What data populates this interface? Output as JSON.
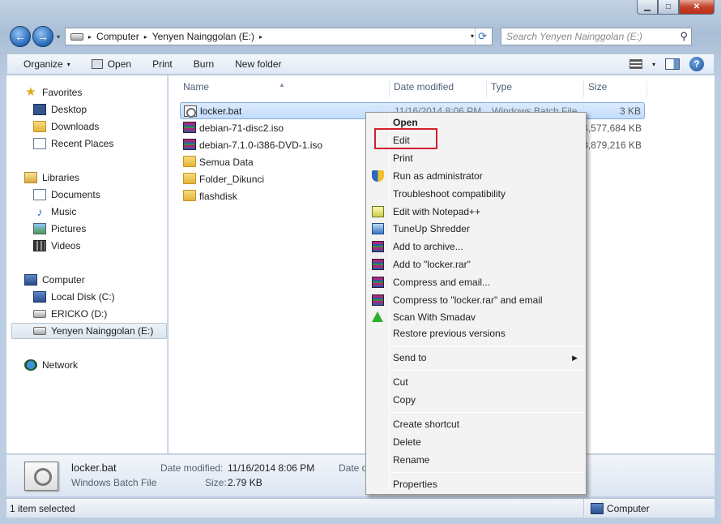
{
  "window": {
    "caption": {
      "minimize": "▁",
      "maximize": "□",
      "close": "✕"
    }
  },
  "nav": {
    "back": "←",
    "forward": "→",
    "dropdown": "▾",
    "address": {
      "segments": [
        "Computer",
        "Yenyen Nainggolan (E:)"
      ],
      "separator": "▸"
    },
    "search_placeholder": "Search Yenyen Nainggolan (E:)"
  },
  "toolbar": {
    "items": [
      "Organize",
      "Open",
      "Print",
      "Burn",
      "New folder"
    ],
    "dropdown_glyph": "▾"
  },
  "navpane": {
    "favorites_header": "Favorites",
    "favorites": [
      "Desktop",
      "Downloads",
      "Recent Places"
    ],
    "libraries_header": "Libraries",
    "libraries": [
      "Documents",
      "Music",
      "Pictures",
      "Videos"
    ],
    "computer_header": "Computer",
    "drives": [
      "Local Disk (C:)",
      "ERICKO (D:)",
      "Yenyen Nainggolan (E:)"
    ],
    "network": "Network"
  },
  "columns": {
    "name": "Name",
    "date": "Date modified",
    "type": "Type",
    "size": "Size"
  },
  "files": [
    {
      "name": "locker.bat",
      "date": "11/16/2014 8:06 PM",
      "type": "Windows Batch File",
      "size": "3 KB",
      "icon": "batch-file-icon"
    },
    {
      "name": "debian-71-disc2.iso",
      "date": "",
      "type": "",
      "size": "4,577,684 KB",
      "icon": "winrar-archive-icon"
    },
    {
      "name": "debian-7.1.0-i386-DVD-1.iso",
      "date": "",
      "type": "",
      "size": "3,879,216 KB",
      "icon": "winrar-archive-icon"
    },
    {
      "name": "Semua Data",
      "date": "",
      "type": "",
      "size": "",
      "icon": "folder-icon"
    },
    {
      "name": "Folder_Dikunci",
      "date": "",
      "type": "",
      "size": "",
      "icon": "folder-icon"
    },
    {
      "name": "flashdisk",
      "date": "",
      "type": "",
      "size": "",
      "icon": "folder-icon"
    }
  ],
  "context_menu": {
    "items": [
      {
        "label": "Open",
        "bold": true,
        "icon": ""
      },
      {
        "label": "Edit",
        "icon": ""
      },
      {
        "label": "Print",
        "icon": ""
      },
      {
        "label": "Run as administrator",
        "icon": "uac-shield-icon"
      },
      {
        "label": "Troubleshoot compatibility",
        "icon": ""
      },
      {
        "label": "Edit with Notepad++",
        "icon": "notepad-plus-plus-icon"
      },
      {
        "label": "TuneUp Shredder",
        "icon": "shredder-icon"
      },
      {
        "label": "Add to archive...",
        "icon": "winrar-icon"
      },
      {
        "label": "Add to \"locker.rar\"",
        "icon": "winrar-icon"
      },
      {
        "label": "Compress and email...",
        "icon": "winrar-icon"
      },
      {
        "label": "Compress to \"locker.rar\" and email",
        "icon": "winrar-icon"
      },
      {
        "label": "Scan With Smadav",
        "icon": "smadav-icon"
      },
      {
        "label": "Restore previous versions",
        "icon": ""
      },
      {
        "label": "Send to",
        "icon": "",
        "submenu": true
      },
      {
        "label": "Cut",
        "icon": ""
      },
      {
        "label": "Copy",
        "icon": ""
      },
      {
        "label": "Create shortcut",
        "icon": ""
      },
      {
        "label": "Delete",
        "icon": ""
      },
      {
        "label": "Rename",
        "icon": ""
      },
      {
        "label": "Properties",
        "icon": ""
      }
    ],
    "submenu_arrow": "▶",
    "highlighted_item": "Edit",
    "highlight_color": "#d2202a"
  },
  "details": {
    "name": "locker.bat",
    "type": "Windows Batch File",
    "date_label": "Date modified:",
    "date_value": "11/16/2014 8:06 PM",
    "size_label": "Size:",
    "size_value": "2.79 KB",
    "extra_label": "Date c"
  },
  "status": {
    "left": "1 item selected",
    "right": "Computer"
  }
}
